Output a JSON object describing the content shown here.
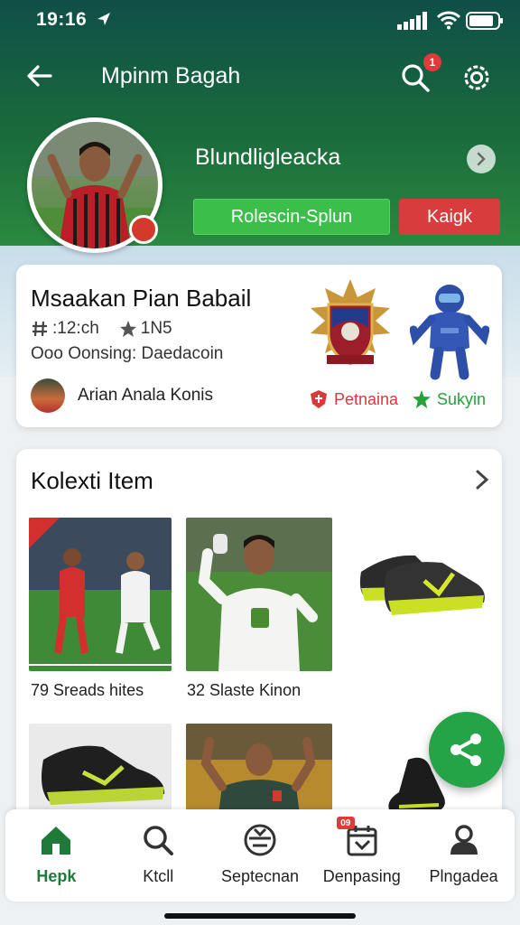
{
  "status_bar": {
    "time": "19:16"
  },
  "nav": {
    "title": "Mpinm Bagah",
    "notification_count": "1"
  },
  "profile": {
    "name": "Blundligleacka",
    "primary_button": "Rolescin-Splun",
    "secondary_button": "Kaigk"
  },
  "info_card": {
    "title": "Msaakan Pian Babail",
    "stat_1": ":12:ch",
    "stat_2": "1N5",
    "subtitle": "Ooo Oonsing: Daedacoin",
    "person_name": "Arian Anala Konis",
    "tag_red": "Petnaina",
    "tag_green": "Sukyin"
  },
  "collection": {
    "title": "Kolexti Item",
    "items": [
      {
        "caption": "79 Sreads hites"
      },
      {
        "caption": "32 Slaste Kinon"
      }
    ]
  },
  "bottom_nav": {
    "items": [
      {
        "label": "Hepk",
        "icon": "home-icon"
      },
      {
        "label": "Ktcll",
        "icon": "search-icon"
      },
      {
        "label": "Septecnan",
        "icon": "ball-icon"
      },
      {
        "label": "Denpasing",
        "icon": "calendar-icon"
      },
      {
        "label": "Plngadea",
        "icon": "profile-icon"
      }
    ],
    "badge": "09"
  },
  "colors": {
    "header_top": "#0f4f48",
    "header_bottom": "#2a8a3f",
    "primary_green": "#3bbf4a",
    "danger_red": "#d93c3c",
    "fab_green": "#24a447",
    "active_nav": "#1f7a3a"
  }
}
